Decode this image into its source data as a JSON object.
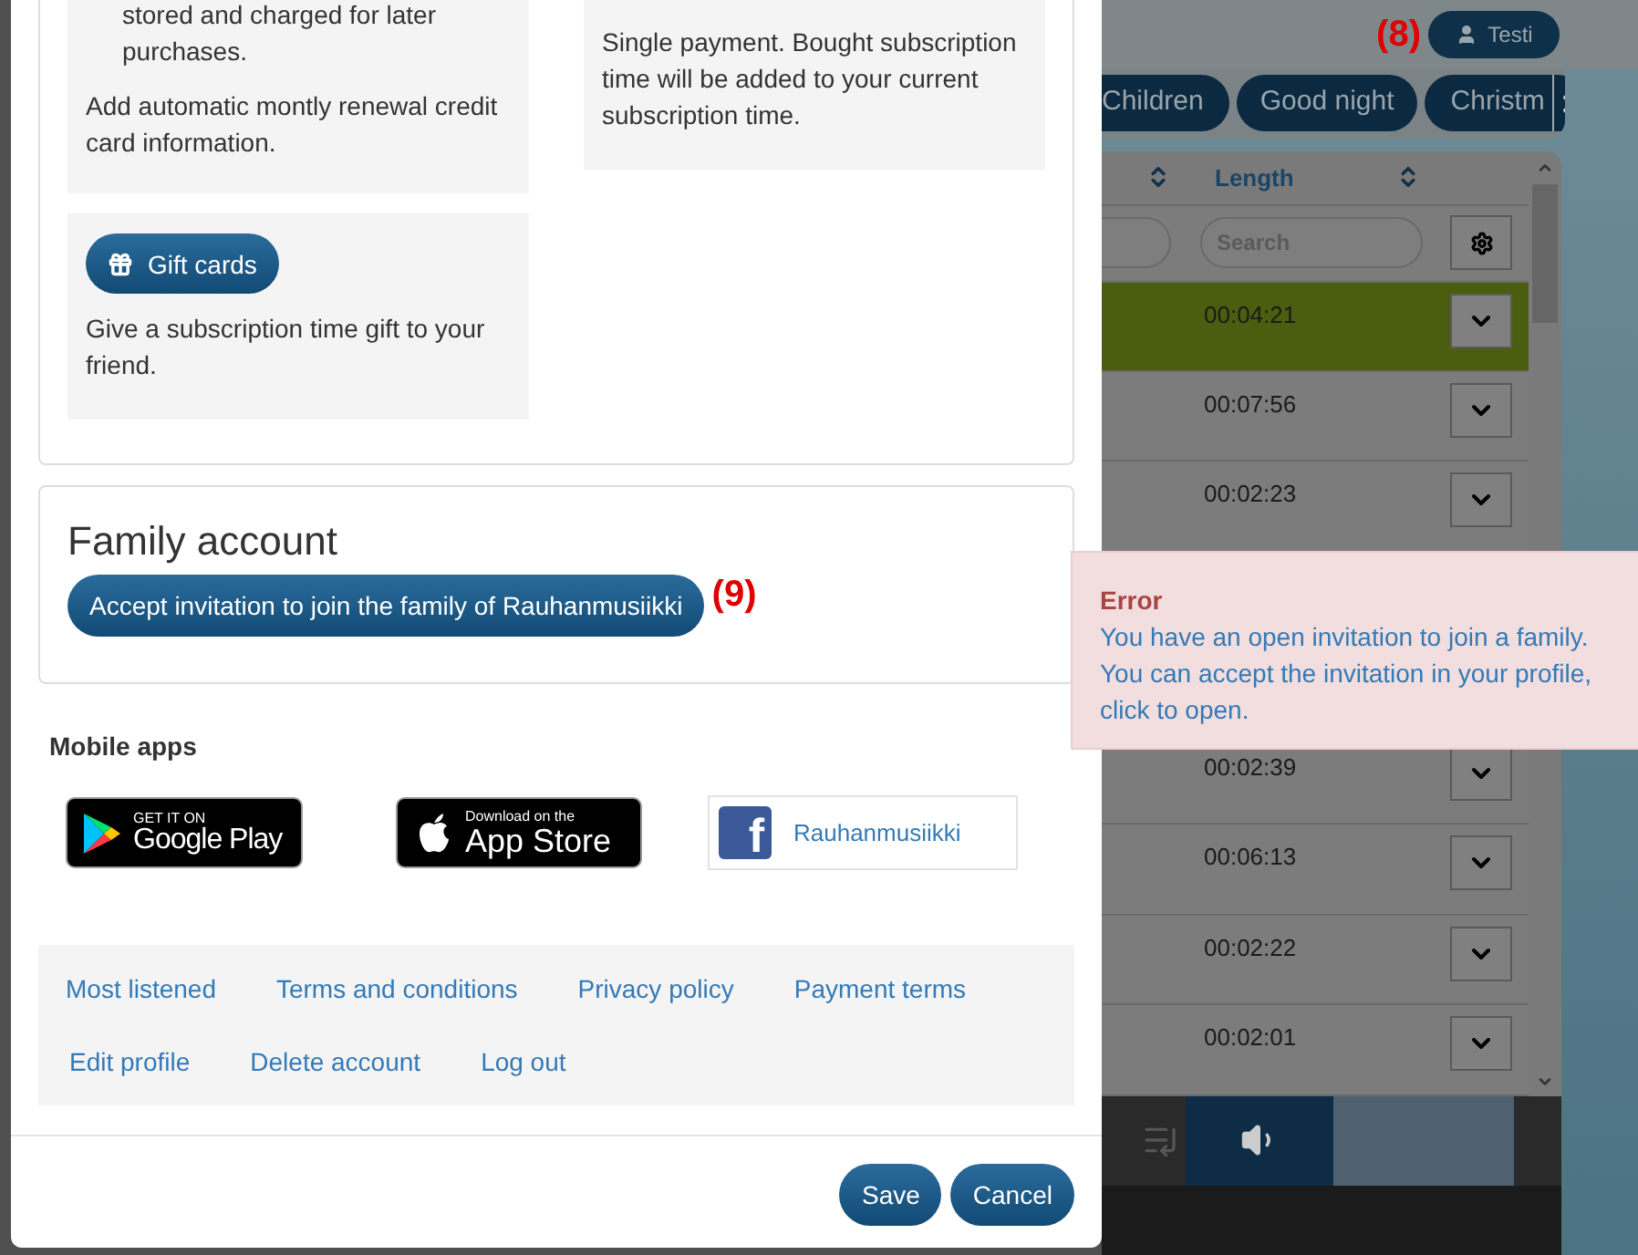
{
  "modal": {
    "subscription": {
      "left_box": {
        "list_item": [
          "stored and charged for later",
          "purchases."
        ],
        "text": "Add automatic montly renewal credit card information."
      },
      "right_box": {
        "text": "Single payment. Bought subscription time will be added to your current subscription time."
      },
      "gift": {
        "button": "Gift cards",
        "text": "Give a subscription time gift to your friend."
      }
    },
    "family": {
      "title": "Family account",
      "button": "Accept invitation to join the family of Rauhanmusiikki",
      "marker": "(9)"
    },
    "mobile_apps": {
      "title": "Mobile apps",
      "google_play": {
        "small": "GET IT ON",
        "large": "Google Play"
      },
      "app_store": {
        "small": "Download on the",
        "large": "App Store"
      },
      "facebook": {
        "logo_letter": "f",
        "label": "Rauhanmusiikki"
      }
    },
    "links": [
      [
        "Most listened",
        "Terms and conditions",
        "Privacy policy",
        "Payment terms"
      ],
      [
        "Edit profile",
        "Delete account",
        "Log out"
      ]
    ],
    "buttons": [
      "Save",
      "Cancel"
    ]
  },
  "background": {
    "marker": "(8)",
    "user": "Testi",
    "tabs": [
      "Children",
      "Good night",
      "Christm"
    ],
    "table": {
      "column": "Length",
      "search_placeholder": "Search",
      "rows_top": [
        {
          "length": "00:04:21",
          "selected": true
        },
        {
          "length": "00:07:56",
          "selected": false
        },
        {
          "length": "00:02:23",
          "selected": false
        }
      ],
      "rows_bottom": [
        {
          "length": "00:02:39",
          "selected": false
        },
        {
          "length": "00:06:13",
          "selected": false
        },
        {
          "length": "00:02:22",
          "selected": false
        },
        {
          "length": "00:02:01",
          "selected": false
        }
      ]
    }
  },
  "toast": {
    "title": "Error",
    "message": "You have an open invitation to join a family. You can accept the invitation in your profile, click to open."
  }
}
